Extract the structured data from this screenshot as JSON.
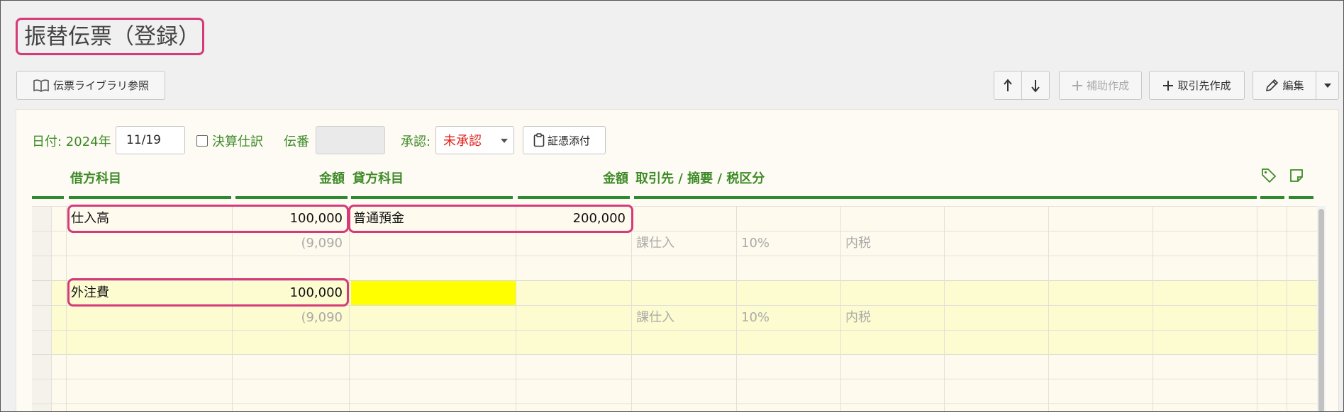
{
  "page": {
    "title": "振替伝票（登録）"
  },
  "toolbar": {
    "library_label": "伝票ライブラリ参照",
    "aux_create_label": "補助作成",
    "partner_create_label": "取引先作成",
    "edit_label": "編集"
  },
  "form": {
    "date_label": "日付: 2024年",
    "date_value": "11/19",
    "closing_label": "決算仕訳",
    "slip_no_label": "伝番",
    "slip_no_value": "",
    "approval_label": "承認:",
    "approval_value": "未承認",
    "attach_label": "証憑添付"
  },
  "columns": {
    "debit_account": "借方科目",
    "debit_amount": "金額",
    "credit_account": "貸方科目",
    "credit_amount": "金額",
    "partner_memo_tax": "取引先 / 摘要 / 税区分"
  },
  "entries": [
    {
      "debit_account": "仕入高",
      "debit_amount": "100,000",
      "debit_tax_amount": "(9,090",
      "credit_account": "普通預金",
      "credit_amount": "200,000",
      "tax_category": "課仕入",
      "tax_rate": "10%",
      "tax_method": "内税"
    },
    {
      "debit_account": "外注費",
      "debit_amount": "100,000",
      "debit_tax_amount": "(9,090",
      "credit_account": "",
      "credit_amount": "",
      "tax_category": "課仕入",
      "tax_rate": "10%",
      "tax_method": "内税"
    }
  ],
  "colors": {
    "accent_green": "#3e8b28",
    "highlight_pink": "#d63a78",
    "selected_cell_yellow": "#ffff00",
    "active_row": "#fdfbd0",
    "unapproved_red": "#e0201a"
  }
}
